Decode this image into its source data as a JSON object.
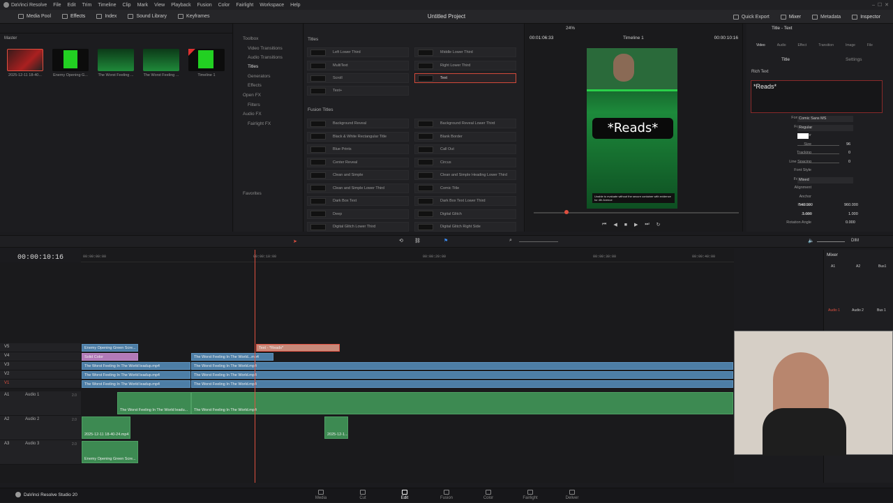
{
  "menu": {
    "app": "DaVinci Resolve",
    "items": [
      "File",
      "Edit",
      "Trim",
      "Timeline",
      "Clip",
      "Mark",
      "View",
      "Playback",
      "Fusion",
      "Color",
      "Fairlight",
      "Workspace",
      "Help"
    ]
  },
  "toolbar": {
    "media_pool": "Media Pool",
    "effects": "Effects",
    "index": "Index",
    "sound_library": "Sound Library",
    "keyframes": "Keyframes",
    "quick_export": "Quick Export",
    "mixer": "Mixer",
    "metadata": "Metadata",
    "inspector": "Inspector"
  },
  "project_title": "Untitled Project",
  "media_pool": {
    "bin": "Master",
    "clips": [
      "2025-12-11 18-40...",
      "Enemy Opening G...",
      "The Worst Feeling ...",
      "The Worst Feeling ...",
      "Timeline 1"
    ]
  },
  "toolbox": {
    "items": [
      "Toolbox",
      "Video Transitions",
      "Audio Transitions",
      "Titles",
      "Generators",
      "Effects",
      "Open FX",
      "Filters",
      "Audio FX",
      "Fairlight FX",
      "Favorites"
    ]
  },
  "effects": {
    "titles_header": "Titles",
    "fusion_header": "Fusion Titles",
    "titles": [
      "Left Lower Third",
      "Middle Lower Third",
      "MultiText",
      "Right Lower Third",
      "Scroll",
      "Text",
      "Text+"
    ],
    "fusion": [
      "Background Reveal",
      "Background Reveal Lower Third",
      "Black & White Rectangular Title",
      "Blank Border",
      "Blue Prints",
      "Call Out",
      "Center Reveal",
      "Circus",
      "Clean and Simple",
      "Clean and Simple Heading Lower Third",
      "Clean and Simple Lower Third",
      "Comic Title",
      "Dark Box Text",
      "Dark Box Text Lower Third",
      "Deep",
      "Digital Glitch",
      "Digital Glitch Lower Third",
      "Digital Glitch Right Side"
    ]
  },
  "viewer": {
    "timecode": "00:01:06:33",
    "zoom": "24%",
    "timeline_name": "Timeline 1",
    "right_timecode": "00:00:10:16",
    "overlay_text": "*Reads*",
    "caption": "Unable to evaluate without the secure container with evidence for 4th Avenue"
  },
  "inspector": {
    "title": "Title - Text",
    "tabs": [
      "Video",
      "Audio",
      "Effect",
      "Transition",
      "Image",
      "File"
    ],
    "subtabs": [
      "Title",
      "Settings"
    ],
    "rich_text_label": "Rich Text",
    "rich_text_value": "*Reads*",
    "font_family_label": "Font Family",
    "font_family": "Comic Sans MS",
    "font_face_label": "Font Face",
    "font_face": "Regular",
    "color_label": "Color",
    "size_label": "Size",
    "size": "96",
    "tracking_label": "Tracking",
    "tracking": "0",
    "line_spacing_label": "Line Spacing",
    "line_spacing": "0",
    "font_style_label": "Font Style",
    "font_case_label": "Font Case",
    "font_case": "Mixed",
    "alignment_label": "Alignment",
    "anchor_label": "Anchor",
    "position_label": "Position",
    "pos_x": "540.000",
    "pos_y": "960.000",
    "zoom_label": "Zoom",
    "zoom_x": "1.000",
    "zoom_y": "1.000",
    "rotation_label": "Rotation Angle",
    "rotation": "0.000"
  },
  "timeline": {
    "timecode": "00:00:10:16",
    "ruler": [
      "00:00:00:00",
      "00:00:10:00",
      "00:00:20:00",
      "00:00:30:00",
      "00:00:40:00"
    ],
    "video_tracks": [
      {
        "id": "V5"
      },
      {
        "id": "V4"
      },
      {
        "id": "V3"
      },
      {
        "id": "V2"
      },
      {
        "id": "V1"
      }
    ],
    "audio_tracks": [
      {
        "id": "A1",
        "name": "Audio 1",
        "level": "2.0"
      },
      {
        "id": "A2",
        "name": "Audio 2",
        "level": "2.0"
      },
      {
        "id": "A3",
        "name": "Audio 3",
        "level": "2.0"
      }
    ],
    "clips": {
      "v5a": "Enemy Opening Green Scre...",
      "v5text": "Text - *Reads*",
      "v4a": "Solid Color",
      "v4b": "The Worst Feeling In The World...mp4",
      "v3a": "The Worst Feeling In The World leadup.mp4",
      "v3b": "The Worst Feeling In The World.mp4",
      "v2a": "The Worst Feeling In The World leadup.mp4",
      "v2b": "The Worst Feeling In The World.mp4",
      "v1a": "The Worst Feeling In The World leadup.mp4",
      "v1b": "The Worst Feeling In The World.mp4",
      "a1a": "The Worst Feeling In The World leadu...",
      "a1b": "The Worst Feeling In The World.mp4",
      "a2a": "2025-12-11 18-40-24.mp4",
      "a2b": "2025-12-1...",
      "a3a": "Enemy Opening Green Scre..."
    }
  },
  "mixer": {
    "title": "Mixer",
    "channels": [
      "A1",
      "A2",
      "Bus1"
    ],
    "names": [
      "Audio 1",
      "Audio 2",
      "Bus 1"
    ],
    "dim": "DIM"
  },
  "pages": [
    "Media",
    "Cut",
    "Edit",
    "Fusion",
    "Color",
    "Fairlight",
    "Deliver"
  ],
  "branding": "DaVinci Resolve Studio 20"
}
